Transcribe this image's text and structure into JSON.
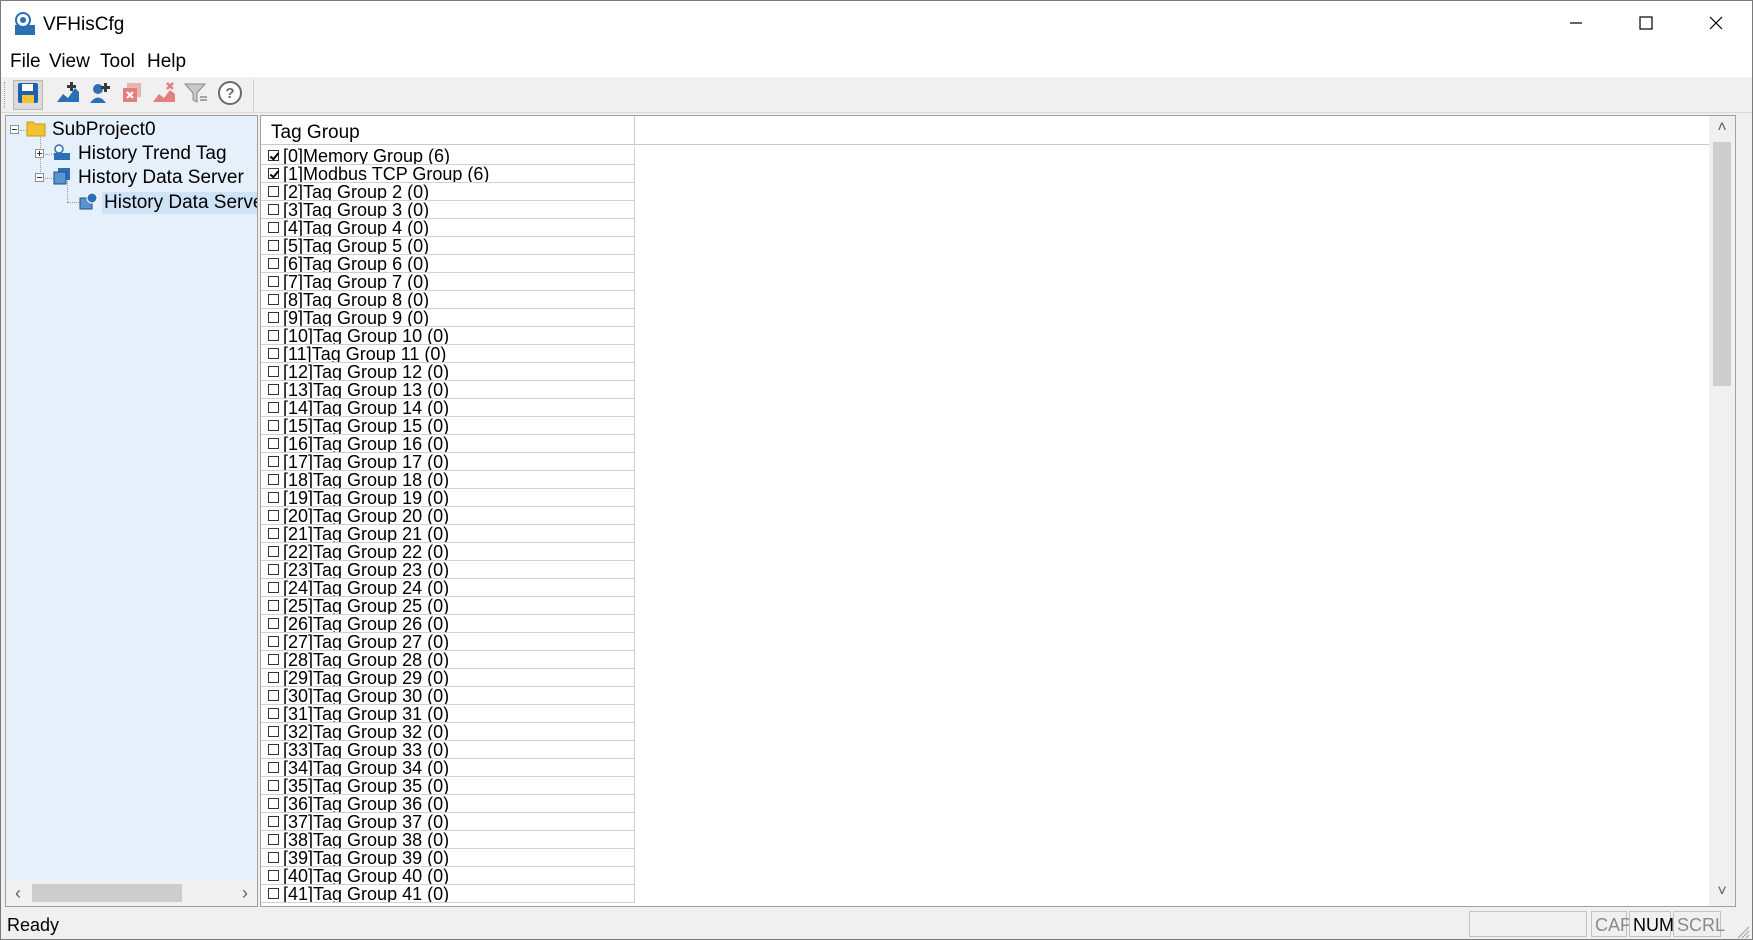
{
  "window": {
    "title": "VFHisCfg"
  },
  "menu": [
    "File",
    "View",
    "Tool",
    "Help"
  ],
  "toolbar": {
    "buttons": [
      {
        "icon": "save-icon"
      },
      {
        "icon": "add-trend-tag-icon"
      },
      {
        "icon": "add-server-icon"
      },
      {
        "icon": "delete-group-icon"
      },
      {
        "icon": "delete-tag-icon"
      },
      {
        "icon": "filter-icon"
      },
      {
        "icon": "help-icon"
      }
    ]
  },
  "tree": {
    "root": "SubProject0",
    "items": [
      {
        "label": "History Trend Tag"
      },
      {
        "label": "History Data Server"
      },
      {
        "label": "History Data Serve"
      }
    ]
  },
  "list": {
    "column_header": "Tag Group",
    "rows": [
      {
        "label": "[0]Memory Group (6)",
        "checked": true
      },
      {
        "label": "[1]Modbus TCP Group (6)",
        "checked": true
      },
      {
        "label": "[2]Tag Group 2 (0)",
        "checked": false
      },
      {
        "label": "[3]Tag Group 3 (0)",
        "checked": false
      },
      {
        "label": "[4]Tag Group 4 (0)",
        "checked": false
      },
      {
        "label": "[5]Tag Group 5 (0)",
        "checked": false
      },
      {
        "label": "[6]Tag Group 6 (0)",
        "checked": false
      },
      {
        "label": "[7]Tag Group 7 (0)",
        "checked": false
      },
      {
        "label": "[8]Tag Group 8 (0)",
        "checked": false
      },
      {
        "label": "[9]Tag Group 9 (0)",
        "checked": false
      },
      {
        "label": "[10]Tag Group 10 (0)",
        "checked": false
      },
      {
        "label": "[11]Tag Group 11 (0)",
        "checked": false
      },
      {
        "label": "[12]Tag Group 12 (0)",
        "checked": false
      },
      {
        "label": "[13]Tag Group 13 (0)",
        "checked": false
      },
      {
        "label": "[14]Tag Group 14 (0)",
        "checked": false
      },
      {
        "label": "[15]Tag Group 15 (0)",
        "checked": false
      },
      {
        "label": "[16]Tag Group 16 (0)",
        "checked": false
      },
      {
        "label": "[17]Tag Group 17 (0)",
        "checked": false
      },
      {
        "label": "[18]Tag Group 18 (0)",
        "checked": false
      },
      {
        "label": "[19]Tag Group 19 (0)",
        "checked": false
      },
      {
        "label": "[20]Tag Group 20 (0)",
        "checked": false
      },
      {
        "label": "[21]Tag Group 21 (0)",
        "checked": false
      },
      {
        "label": "[22]Tag Group 22 (0)",
        "checked": false
      },
      {
        "label": "[23]Tag Group 23 (0)",
        "checked": false
      },
      {
        "label": "[24]Tag Group 24 (0)",
        "checked": false
      },
      {
        "label": "[25]Tag Group 25 (0)",
        "checked": false
      },
      {
        "label": "[26]Tag Group 26 (0)",
        "checked": false
      },
      {
        "label": "[27]Tag Group 27 (0)",
        "checked": false
      },
      {
        "label": "[28]Tag Group 28 (0)",
        "checked": false
      },
      {
        "label": "[29]Tag Group 29 (0)",
        "checked": false
      },
      {
        "label": "[30]Tag Group 30 (0)",
        "checked": false
      },
      {
        "label": "[31]Tag Group 31 (0)",
        "checked": false
      },
      {
        "label": "[32]Tag Group 32 (0)",
        "checked": false
      },
      {
        "label": "[33]Tag Group 33 (0)",
        "checked": false
      },
      {
        "label": "[34]Tag Group 34 (0)",
        "checked": false
      },
      {
        "label": "[35]Tag Group 35 (0)",
        "checked": false
      },
      {
        "label": "[36]Tag Group 36 (0)",
        "checked": false
      },
      {
        "label": "[37]Tag Group 37 (0)",
        "checked": false
      },
      {
        "label": "[38]Tag Group 38 (0)",
        "checked": false
      },
      {
        "label": "[39]Tag Group 39 (0)",
        "checked": false
      },
      {
        "label": "[40]Tag Group 40 (0)",
        "checked": false
      },
      {
        "label": "[41]Tag Group 41 (0)",
        "checked": false
      }
    ]
  },
  "status": {
    "text": "Ready",
    "cap": "CAP",
    "num": "NUM",
    "scrl": "SCRL"
  }
}
